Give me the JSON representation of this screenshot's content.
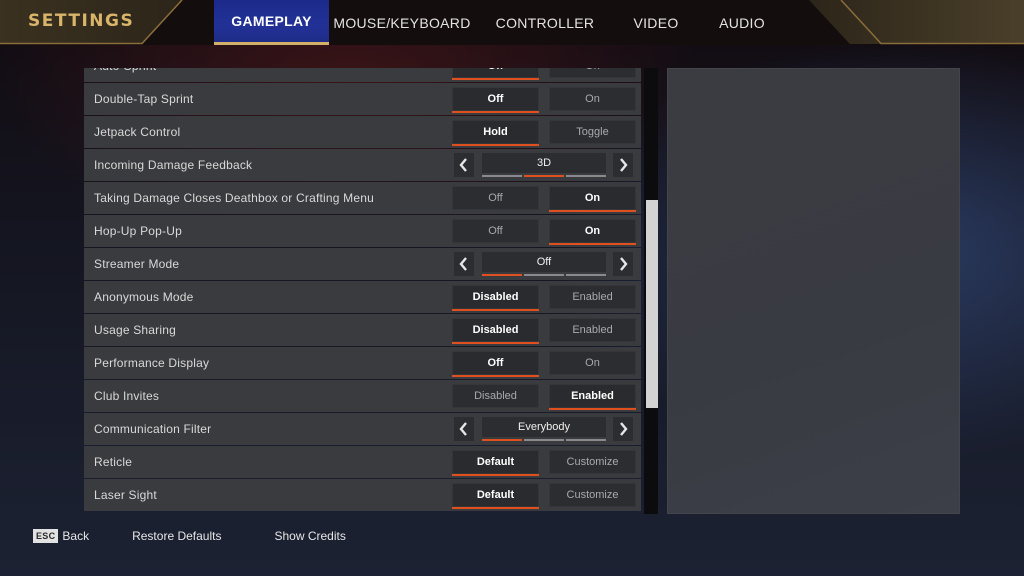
{
  "header": {
    "title": "SETTINGS",
    "tabs": [
      {
        "label": "GAMEPLAY",
        "active": true
      },
      {
        "label": "MOUSE/KEYBOARD",
        "active": false
      },
      {
        "label": "CONTROLLER",
        "active": false
      },
      {
        "label": "VIDEO",
        "active": false
      },
      {
        "label": "AUDIO",
        "active": false
      }
    ]
  },
  "colors": {
    "accent_selected": "#e0501f",
    "title_gold": "#d9b56a",
    "active_tab_blue": "#223196"
  },
  "settings": [
    {
      "label": "Auto-Sprint",
      "type": "toggle",
      "options": [
        "Off",
        "On"
      ],
      "selected": 0
    },
    {
      "label": "Double-Tap Sprint",
      "type": "toggle",
      "options": [
        "Off",
        "On"
      ],
      "selected": 0
    },
    {
      "label": "Jetpack Control",
      "type": "toggle",
      "options": [
        "Hold",
        "Toggle"
      ],
      "selected": 0
    },
    {
      "label": "Incoming Damage Feedback",
      "type": "cycler",
      "value": "3D",
      "option_count": 3,
      "selected_index": 1
    },
    {
      "label": "Taking Damage Closes Deathbox or Crafting Menu",
      "type": "toggle",
      "options": [
        "Off",
        "On"
      ],
      "selected": 1
    },
    {
      "label": "Hop-Up Pop-Up",
      "type": "toggle",
      "options": [
        "Off",
        "On"
      ],
      "selected": 1
    },
    {
      "label": "Streamer Mode",
      "type": "cycler",
      "value": "Off",
      "option_count": 3,
      "selected_index": 0
    },
    {
      "label": "Anonymous Mode",
      "type": "toggle",
      "options": [
        "Disabled",
        "Enabled"
      ],
      "selected": 0
    },
    {
      "label": "Usage Sharing",
      "type": "toggle",
      "options": [
        "Disabled",
        "Enabled"
      ],
      "selected": 0
    },
    {
      "label": "Performance Display",
      "type": "toggle",
      "options": [
        "Off",
        "On"
      ],
      "selected": 0
    },
    {
      "label": "Club Invites",
      "type": "toggle",
      "options": [
        "Disabled",
        "Enabled"
      ],
      "selected": 1
    },
    {
      "label": "Communication Filter",
      "type": "cycler",
      "value": "Everybody",
      "option_count": 3,
      "selected_index": 0
    },
    {
      "label": "Reticle",
      "type": "toggle",
      "options": [
        "Default",
        "Customize"
      ],
      "selected": 0
    },
    {
      "label": "Laser Sight",
      "type": "toggle",
      "options": [
        "Default",
        "Customize"
      ],
      "selected": 0
    }
  ],
  "footer": {
    "esc_key": "ESC",
    "back": "Back",
    "restore_defaults": "Restore Defaults",
    "show_credits": "Show Credits"
  },
  "icons": {
    "cycler_left": "chevron-left-icon",
    "cycler_right": "chevron-right-icon"
  }
}
